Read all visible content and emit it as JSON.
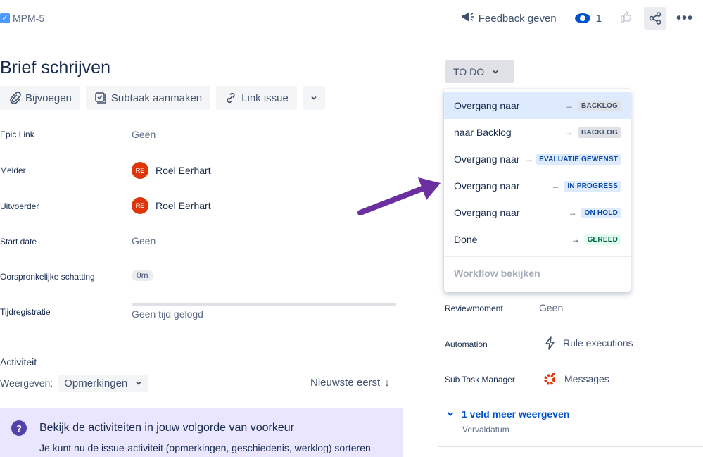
{
  "header": {
    "issue_key": "MPM-5",
    "feedback_label": "Feedback geven",
    "watch_count": "1"
  },
  "issue": {
    "title": "Brief schrijven",
    "toolbar": {
      "attach": "Bijvoegen",
      "subtask": "Subtaak aanmaken",
      "link": "Link issue"
    }
  },
  "fields": {
    "epic_link": {
      "label": "Epic Link",
      "value": "Geen"
    },
    "reporter": {
      "label": "Melder",
      "initials": "RE",
      "value": "Roel Eerhart"
    },
    "assignee": {
      "label": "Uitvoerder",
      "initials": "RE",
      "value": "Roel Eerhart"
    },
    "start_date": {
      "label": "Start date",
      "value": "Geen"
    },
    "estimate": {
      "label": "Oorspronkelijke schatting",
      "value": "0m"
    },
    "time_tracking": {
      "label": "Tijdregistratie",
      "value": "Geen tijd gelogd"
    }
  },
  "activity": {
    "title": "Activiteit",
    "show_label": "Weergeven:",
    "filter_value": "Opmerkingen",
    "sort_label": "Nieuwste eerst",
    "info_title": "Bekijk de activiteiten in jouw volgorde van voorkeur",
    "info_text": "Je kunt nu de issue-activiteit (opmerkingen, geschiedenis, werklog) sorteren"
  },
  "status": {
    "current": "TO DO",
    "transitions": [
      {
        "label": "Overgang naar",
        "target": "BACKLOG",
        "color": "grey"
      },
      {
        "label": "naar Backlog",
        "target": "BACKLOG",
        "color": "grey"
      },
      {
        "label": "Overgang naar",
        "target": "EVALUATIE GEWENST",
        "color": "blue"
      },
      {
        "label": "Overgang naar",
        "target": "IN PROGRESS",
        "color": "blue"
      },
      {
        "label": "Overgang naar",
        "target": "ON HOLD",
        "color": "blue"
      },
      {
        "label": "Done",
        "target": "GEREED",
        "color": "green"
      }
    ],
    "workflow_link": "Workflow bekijken"
  },
  "right_fields": {
    "review": {
      "label": "Reviewmoment",
      "value": "Geen"
    },
    "automation": {
      "label": "Automation",
      "value": "Rule executions"
    },
    "subtask_manager": {
      "label": "Sub Task Manager",
      "value": "Messages"
    },
    "more_fields": "1 veld meer weergeven",
    "more_fields_sub": "Vervaldatum"
  },
  "colors": {
    "accent": "#0052cc",
    "annotation_arrow": "#6b2fa0",
    "info_bg": "#eae6ff",
    "avatar": "#de350b"
  }
}
